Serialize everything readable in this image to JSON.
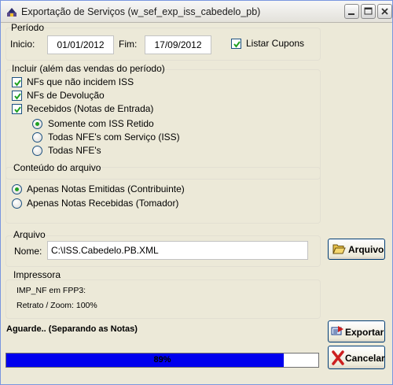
{
  "window": {
    "title": "Exportação de Serviços (w_sef_exp_iss_cabedelo_pb)"
  },
  "periodo": {
    "label": "Período",
    "inicio_label": "Inicio:",
    "inicio_value": "01/01/2012",
    "fim_label": "Fim:",
    "fim_value": "17/09/2012",
    "listar_cupons_label": "Listar Cupons",
    "listar_cupons_checked": true
  },
  "incluir": {
    "label": "Incluir (além das vendas do período)",
    "items": [
      {
        "label": "NFs que não incidem ISS",
        "checked": true
      },
      {
        "label": "NFs de Devolução",
        "checked": true
      },
      {
        "label": "Recebidos (Notas de Entrada)",
        "checked": true
      }
    ],
    "radios": [
      {
        "label": "Somente com ISS Retido",
        "selected": true
      },
      {
        "label": "Todas NFE's com Serviço (ISS)",
        "selected": false
      },
      {
        "label": "Todas NFE's",
        "selected": false
      }
    ]
  },
  "conteudo": {
    "label": "Conteúdo do arquivo",
    "options": [
      {
        "label": "Apenas Notas Emitidas (Contribuinte)",
        "selected": true
      },
      {
        "label": "Apenas Notas Recebidas (Tomador)",
        "selected": false
      }
    ]
  },
  "arquivo": {
    "label": "Arquivo",
    "nome_label": "Nome:",
    "nome_value": "C:\\ISS.Cabedelo.PB.XML",
    "button_label": "Arquivo"
  },
  "impressora": {
    "label": "Impressora",
    "line1": "IMP_NF em FPP3:",
    "line2": "Retrato / Zoom: 100%"
  },
  "status": {
    "text": "Aguarde.. (Separando as Notas)"
  },
  "progress": {
    "percent": 89,
    "text": "89%"
  },
  "actions": {
    "exportar_label": "Exportar",
    "cancelar_label": "Cancelar"
  },
  "colors": {
    "progress_fill": "#0000ee",
    "check_mark": "#21a121",
    "cancel_x": "#cc1f1f"
  }
}
